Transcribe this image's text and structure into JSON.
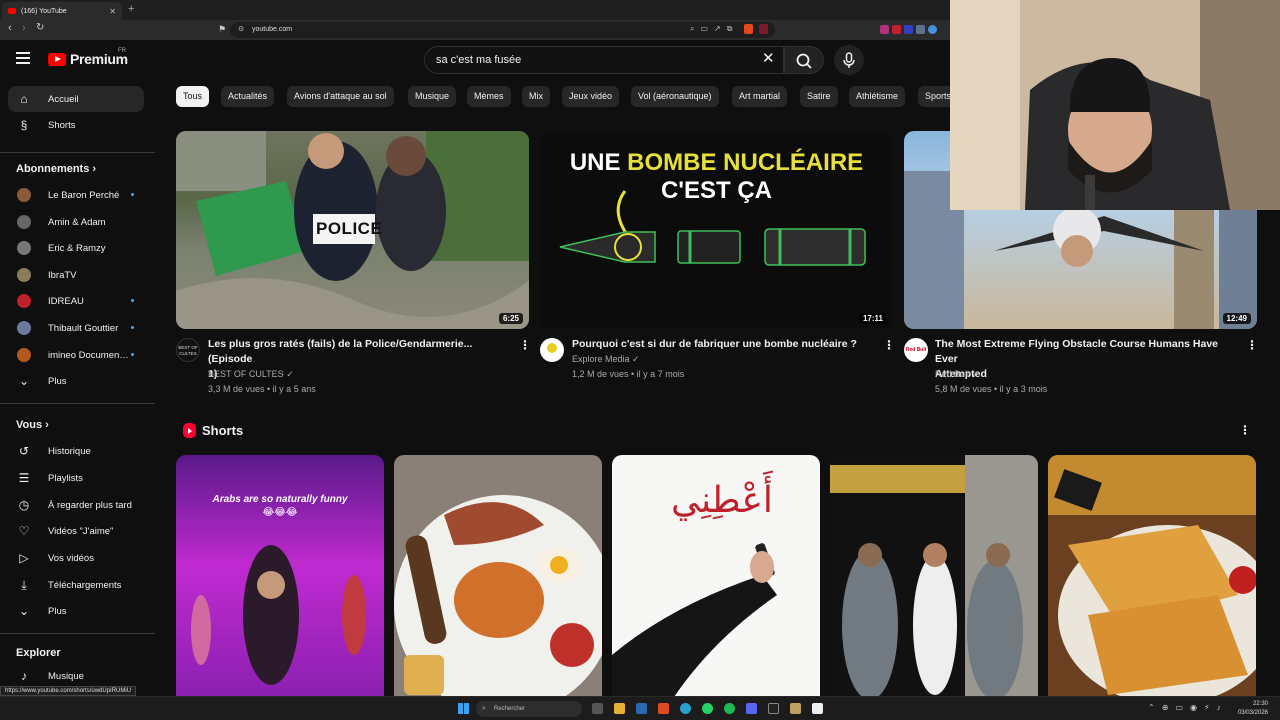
{
  "browser": {
    "tab_title": "(166) YouTube",
    "url": "youtube.com",
    "status_url": "https://www.youtube.com/shorts/uwdUpIRUMiU"
  },
  "header": {
    "logo": "Premium",
    "country": "FR",
    "search_value": "sa c'est ma fusée"
  },
  "sidebar": {
    "main": [
      {
        "label": "Accueil",
        "icon": "home-icon"
      },
      {
        "label": "Shorts",
        "icon": "shorts-icon"
      }
    ],
    "subs_title": "Abonnements",
    "subs": [
      {
        "label": "Le Baron Perché",
        "color": "#8a5a3a"
      },
      {
        "label": "Amin & Adam",
        "color": "#666666"
      },
      {
        "label": "Eric & Ramzy",
        "color": "#777777"
      },
      {
        "label": "IbraTV",
        "color": "#8b7d5a"
      },
      {
        "label": "IDREAU",
        "color": "#c0202a"
      },
      {
        "label": "Thibault Gouttier",
        "color": "#6a7a9a"
      },
      {
        "label": "imineo Documen…",
        "color": "#b05a20"
      }
    ],
    "subs_more": "Plus",
    "you_title": "Vous",
    "you": [
      {
        "label": "Historique",
        "icon": "history-icon"
      },
      {
        "label": "Playlists",
        "icon": "playlist-icon"
      },
      {
        "label": "À regarder plus tard",
        "icon": "clock-icon"
      },
      {
        "label": "Vidéos \"J'aime\"",
        "icon": "thumbs-up-icon"
      },
      {
        "label": "Vos vidéos",
        "icon": "video-icon"
      },
      {
        "label": "Téléchargements",
        "icon": "download-icon"
      }
    ],
    "you_more": "Plus",
    "explore_title": "Explorer",
    "explore": [
      {
        "label": "Musique",
        "icon": "music-icon"
      }
    ]
  },
  "chips": [
    "Tous",
    "Actualités",
    "Avions d'attaque au sol",
    "Musique",
    "Mèmes",
    "Mix",
    "Jeux vidéo",
    "Vol (aéronautique)",
    "Art martial",
    "Satire",
    "Athlétisme",
    "Sports"
  ],
  "videos": [
    {
      "title_1": "Les plus gros ratés (fails) de la Police/Gendarmerie... (Episode",
      "title_2": "1)",
      "channel": "BEST OF CULTES",
      "meta": "3,3 M de vues • il y a 5 ans",
      "duration": "6:25",
      "thumb_text": "POLICE",
      "avatar_text": "BEST OF CULTES"
    },
    {
      "title_1": "Pourquoi c'est si dur de fabriquer une bombe nucléaire ?",
      "title_2": "",
      "channel": "Explore Media",
      "meta": "1,2 M de vues • il y a 7 mois",
      "duration": "17:11",
      "thumb_line1_a": "UNE ",
      "thumb_line1_b": "BOMBE NUCLÉAIRE",
      "thumb_line2": "C'EST ÇA"
    },
    {
      "title_1": "The Most Extreme Flying Obstacle Course Humans Have Ever",
      "title_2": "Attempted",
      "channel": "Red Bull",
      "meta": "5,8 M de vues • il y a 3 mois",
      "duration": "12:49",
      "avatar_text": "Red Bull"
    }
  ],
  "shorts": {
    "title": "Shorts",
    "items": [
      {
        "caption": "Arabs are so naturally funny 😂😂😂"
      },
      {
        "caption": ""
      },
      {
        "caption": "أَعْطِنِي"
      },
      {
        "caption": ""
      },
      {
        "caption": ""
      }
    ]
  },
  "taskbar": {
    "search_placeholder": "Rechercher",
    "time": "22:30",
    "date": "03/03/2026"
  }
}
